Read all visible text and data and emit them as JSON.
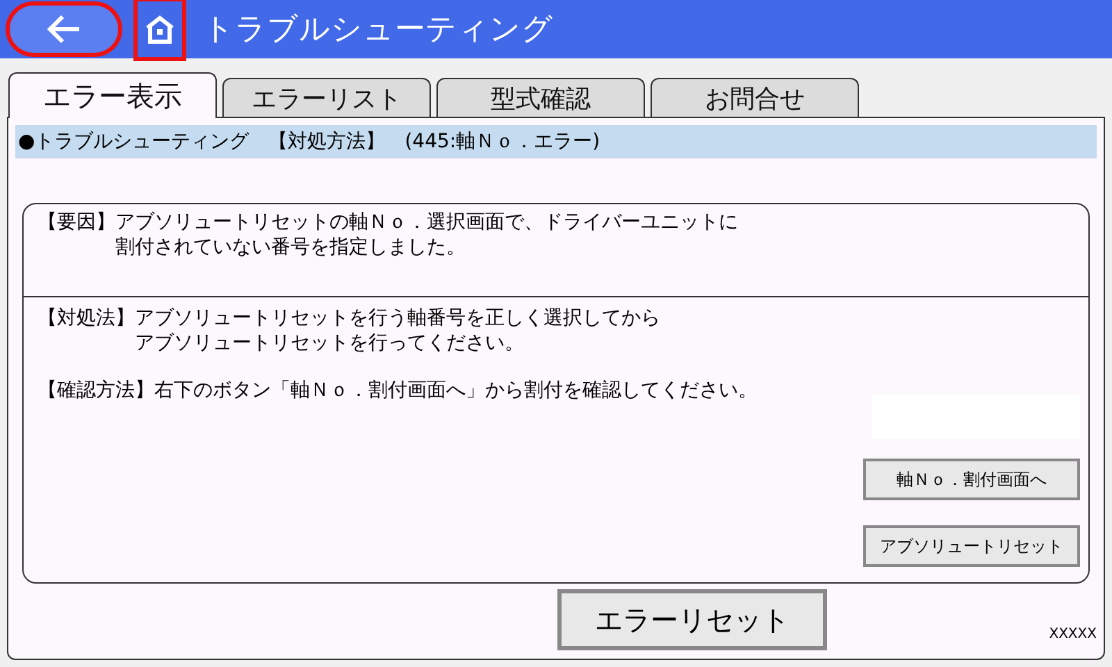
{
  "header": {
    "title": "トラブルシューティング",
    "back_button": {
      "highlighted": true
    },
    "home_button": {
      "highlighted": true
    }
  },
  "tabs": [
    {
      "label": "エラー表示",
      "selected": true
    },
    {
      "label": "エラーリスト",
      "selected": false
    },
    {
      "label": "型式確認",
      "selected": false
    },
    {
      "label": "お問合せ",
      "selected": false
    }
  ],
  "info_bar": "●トラブルシューティング　【対処方法】　(445:軸Ｎｏ．エラー)",
  "cause": {
    "label": "【要因】",
    "lines": [
      "アブソリュートリセットの軸Ｎｏ．選択画面で、ドライバーユニットに",
      "割付されていない番号を指定しました。"
    ]
  },
  "remedy": {
    "label": "【対処法】",
    "lines": [
      "アブソリュートリセットを行う軸番号を正しく選択してから",
      "アブソリュートリセットを行ってください。"
    ]
  },
  "check": {
    "label": "【確認方法】",
    "text": "右下のボタン「軸Ｎｏ．割付画面へ」から割付を確認してください。"
  },
  "side_buttons": [
    "軸Ｎｏ．割付画面へ",
    "アブソリュートリセット"
  ],
  "reset_button": "エラーリセット",
  "footer_code": "XXXXX"
}
